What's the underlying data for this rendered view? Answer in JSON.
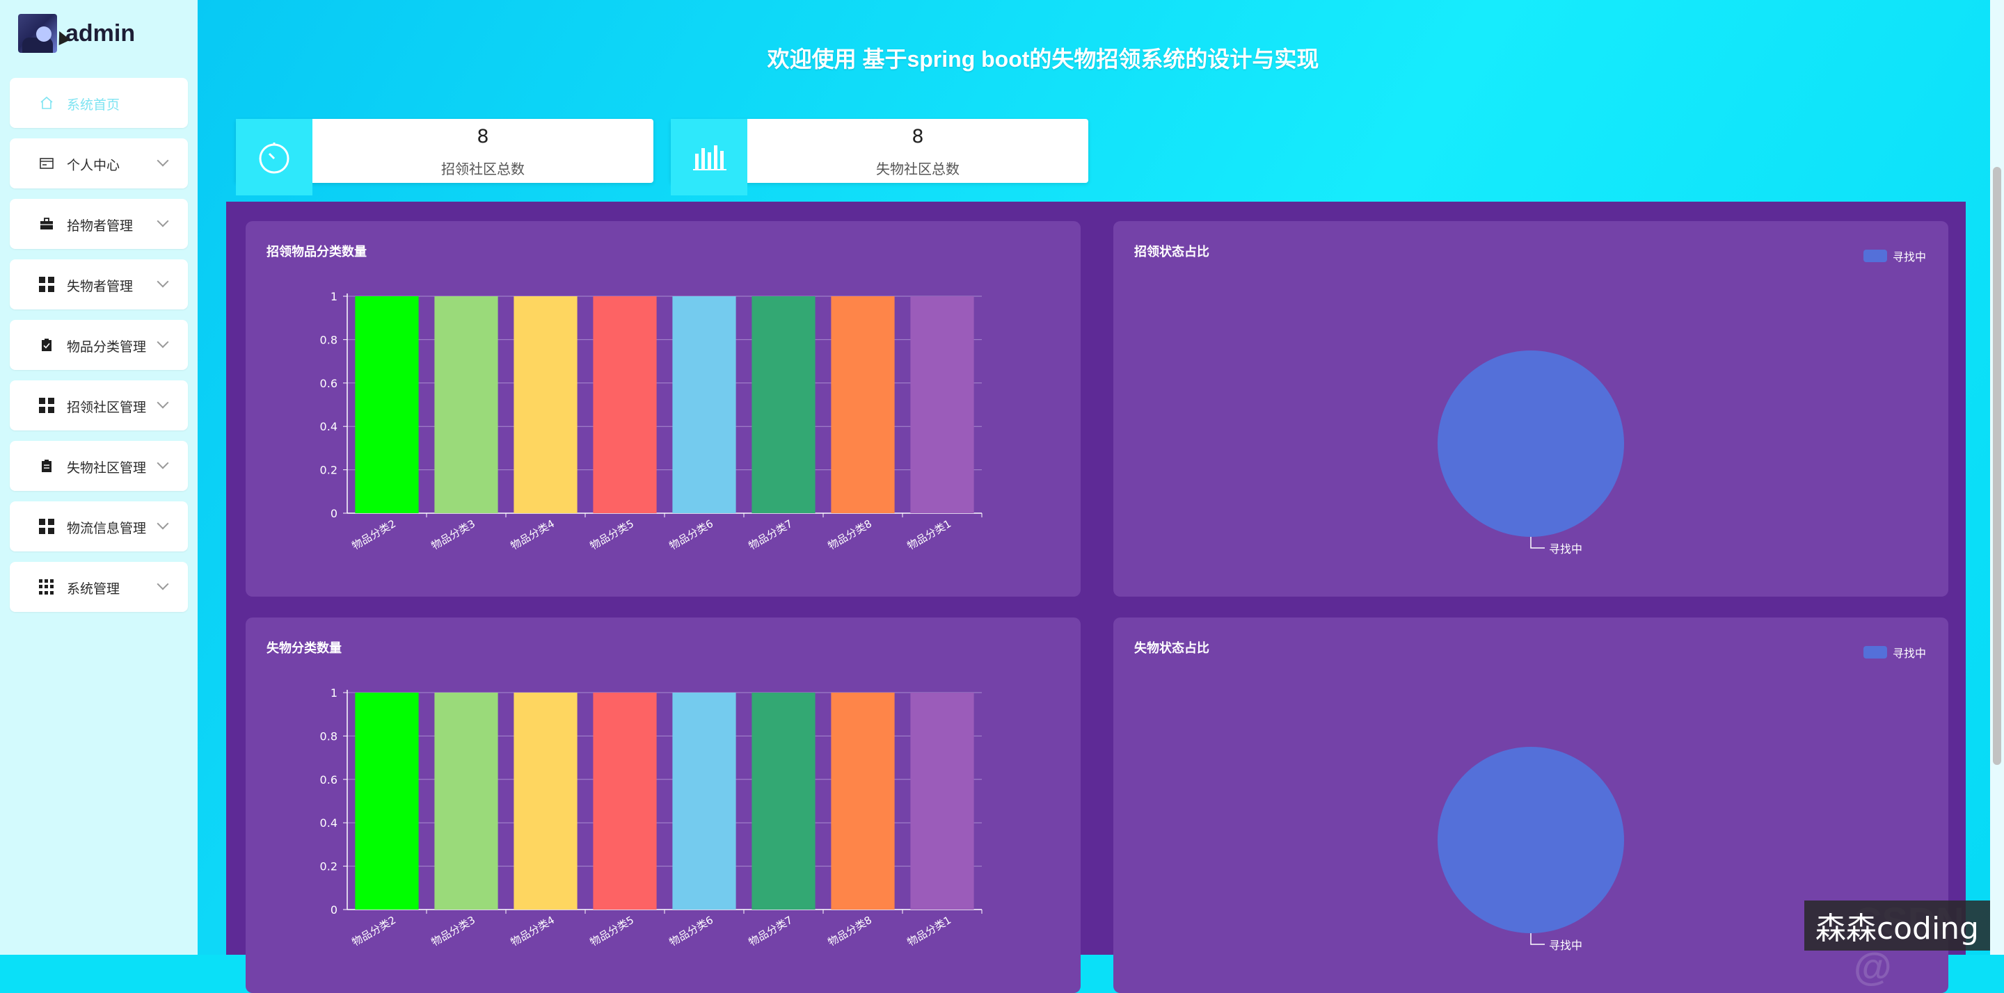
{
  "brand": {
    "username": "admin"
  },
  "sidebar": {
    "items": [
      {
        "label": "系统首页",
        "icon": "home-icon",
        "active": true,
        "has_submenu": false
      },
      {
        "label": "个人中心",
        "icon": "id-card-icon",
        "active": false,
        "has_submenu": true
      },
      {
        "label": "拾物者管理",
        "icon": "briefcase-icon",
        "active": false,
        "has_submenu": true
      },
      {
        "label": "失物者管理",
        "icon": "grid-icon",
        "active": false,
        "has_submenu": true
      },
      {
        "label": "物品分类管理",
        "icon": "clipboard-icon",
        "active": false,
        "has_submenu": true
      },
      {
        "label": "招领社区管理",
        "icon": "grid-icon",
        "active": false,
        "has_submenu": true
      },
      {
        "label": "失物社区管理",
        "icon": "clipboard-icon",
        "active": false,
        "has_submenu": true
      },
      {
        "label": "物流信息管理",
        "icon": "grid-icon",
        "active": false,
        "has_submenu": true
      },
      {
        "label": "系统管理",
        "icon": "apps-icon",
        "active": false,
        "has_submenu": true
      }
    ]
  },
  "header": {
    "title": "欢迎使用 基于spring boot的失物招领系统的设计与实现"
  },
  "stats": [
    {
      "value": "8",
      "label": "招领社区总数",
      "icon": "stopwatch-icon"
    },
    {
      "value": "8",
      "label": "失物社区总数",
      "icon": "bar-chart-icon"
    }
  ],
  "colors": {
    "bars": [
      "#00ff00",
      "#9ada7a",
      "#fed660",
      "#fd6364",
      "#74cbee",
      "#33a873",
      "#fe8549",
      "#9b5cba"
    ],
    "pie": "#5470d9",
    "panel": "#7442a8",
    "panel_bg": "#5e2a96"
  },
  "chart_data": [
    {
      "type": "bar",
      "title": "招领物品分类数量",
      "categories": [
        "物品分类2",
        "物品分类3",
        "物品分类4",
        "物品分类5",
        "物品分类6",
        "物品分类7",
        "物品分类8",
        "物品分类1"
      ],
      "values": [
        1,
        1,
        1,
        1,
        1,
        1,
        1,
        1
      ],
      "yticks": [
        "0",
        "0.2",
        "0.4",
        "0.6",
        "0.8",
        "1"
      ],
      "ylim": [
        0,
        1
      ]
    },
    {
      "type": "pie",
      "title": "招领状态占比",
      "slices": [
        {
          "name": "寻找中",
          "value": 1
        }
      ],
      "legend": [
        "寻找中"
      ],
      "legend_position": "top-right"
    },
    {
      "type": "bar",
      "title": "失物分类数量",
      "categories": [
        "物品分类2",
        "物品分类3",
        "物品分类4",
        "物品分类5",
        "物品分类6",
        "物品分类7",
        "物品分类8",
        "物品分类1"
      ],
      "values": [
        1,
        1,
        1,
        1,
        1,
        1,
        1,
        1
      ],
      "yticks": [
        "0",
        "0.2",
        "0.4",
        "0.6",
        "0.8",
        "1"
      ],
      "ylim": [
        0,
        1
      ]
    },
    {
      "type": "pie",
      "title": "失物状态占比",
      "slices": [
        {
          "name": "寻找中",
          "value": 1
        }
      ],
      "legend": [
        "寻找中"
      ],
      "legend_position": "top-right"
    }
  ],
  "watermark": {
    "text": "森森coding",
    "ghost": "CSDN @"
  }
}
